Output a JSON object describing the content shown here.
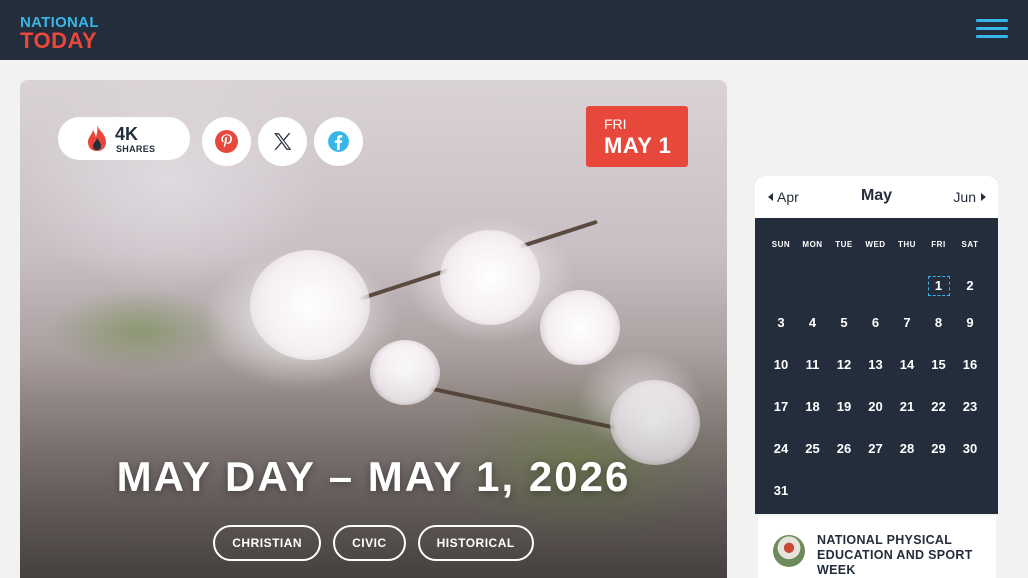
{
  "brand": {
    "line1": "NATIONAL",
    "line2": "TODAY",
    "accent": "#38b6e8",
    "red": "#e8473b",
    "navy": "#242d3c"
  },
  "hero": {
    "share_count": "4K",
    "share_label": "SHARES",
    "social": [
      "pinterest-icon",
      "x-icon",
      "facebook-icon"
    ],
    "date_dow": "FRI",
    "date_md": "MAY 1",
    "title": "May Day – May 1, 2026",
    "tags": [
      "CHRISTIAN",
      "CIVIC",
      "HISTORICAL"
    ]
  },
  "calendar": {
    "prev": "Apr",
    "month": "May",
    "next": "Jun",
    "weekdays": [
      "SUN",
      "MON",
      "TUE",
      "WED",
      "THU",
      "FRI",
      "SAT"
    ],
    "first_weekday_index": 5,
    "days": 31,
    "today": 1
  },
  "event": {
    "title": "National Physical Education and Sport Week"
  }
}
